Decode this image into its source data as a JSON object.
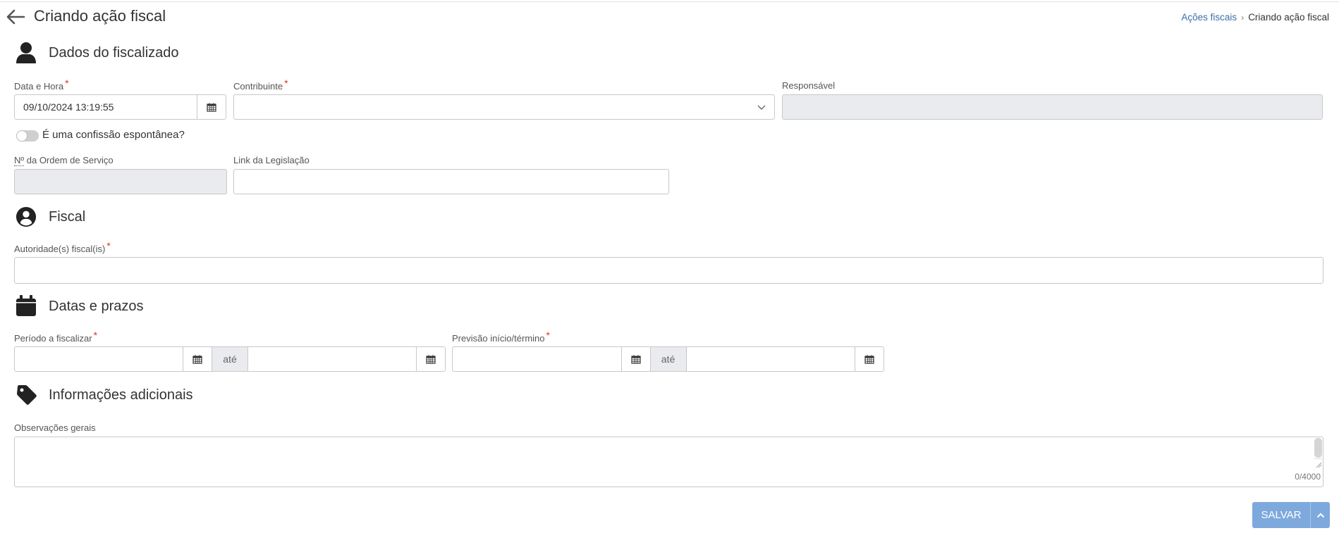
{
  "header": {
    "title": "Criando ação fiscal",
    "back_icon": "arrow-left-icon",
    "breadcrumb": {
      "parent": "Ações fiscais",
      "separator": "›",
      "current": "Criando ação fiscal"
    }
  },
  "sections": {
    "fiscalizado": {
      "title": "Dados do fiscalizado",
      "icon": "user-icon",
      "data_hora": {
        "label": "Data e Hora",
        "required": "*",
        "value": "09/10/2024 13:19:55",
        "icon": "calendar-icon"
      },
      "contribuinte": {
        "label": "Contribuinte",
        "required": "*",
        "value": "",
        "icon": "chevron-down-icon"
      },
      "responsavel": {
        "label": "Responsável",
        "value": ""
      },
      "confissao": {
        "label": "É uma confissão espontânea?",
        "checked": false
      },
      "ordem_servico": {
        "label_abbr": "Nº",
        "label_rest": " da Ordem de Serviço",
        "value": ""
      },
      "link_legislacao": {
        "label": "Link da Legislação",
        "value": ""
      }
    },
    "fiscal": {
      "title": "Fiscal",
      "icon": "user-circle-icon",
      "autoridades": {
        "label": "Autoridade(s) fiscal(is)",
        "required": "*",
        "value": ""
      }
    },
    "datas": {
      "title": "Datas e prazos",
      "icon": "calendar-icon",
      "periodo": {
        "label": "Período a fiscalizar",
        "required": "*",
        "from": "",
        "separator": "até",
        "to": ""
      },
      "previsao": {
        "label": "Previsão início/término",
        "required": "*",
        "from": "",
        "separator": "até",
        "to": ""
      }
    },
    "info": {
      "title": "Informações adicionais",
      "icon": "tag-icon",
      "observacoes": {
        "label": "Observações gerais",
        "value": "",
        "counter": "0/4000"
      }
    }
  },
  "actions": {
    "save_label": "SALVAR",
    "save_color": "#7ea9dc",
    "toggle_icon": "chevron-up-icon"
  }
}
